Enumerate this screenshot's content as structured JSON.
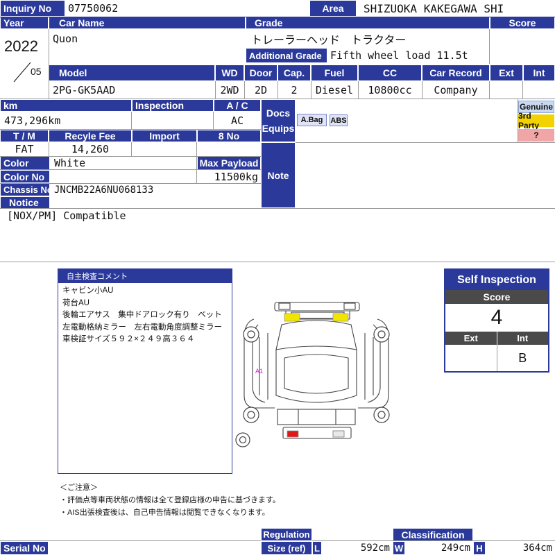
{
  "labels": {
    "inquiry_no": "Inquiry No",
    "area": "Area",
    "year": "Year",
    "car_name": "Car Name",
    "grade": "Grade",
    "score": "Score",
    "additional_grade": "Additional Grade",
    "model": "Model",
    "wd": "WD",
    "door": "Door",
    "cap": "Cap.",
    "fuel": "Fuel",
    "cc": "CC",
    "car_record": "Car Record",
    "ext": "Ext",
    "int": "Int",
    "km": "km",
    "inspection": "Inspection",
    "ac": "A / C",
    "docs": "Docs",
    "equips": "Equips",
    "tm": "T / M",
    "recyle_fee": "Recyle Fee",
    "import": "Import",
    "eight_no": "8 No",
    "color": "Color",
    "max_payload": "Max Payload",
    "color_no": "Color No",
    "note": "Note",
    "chassis_no": "Chassis No",
    "notice": "Notice",
    "serial_no": "Serial No",
    "regulation": "Regulation",
    "size_ref": "Size (ref)",
    "classification": "Classification",
    "size_l": "L",
    "size_w": "W",
    "size_h": "H"
  },
  "vehicle": {
    "inquiry_no": "07750062",
    "area": "SHIZUOKA KAKEGAWA SHI",
    "year": "2022",
    "month": "05",
    "car_name": "Quon",
    "grade": "トレーラーヘッド　トラクター",
    "additional_grade": "Fifth wheel load 11.5t",
    "model": "2PG-GK5AAD",
    "wd": "2WD",
    "door": "2D",
    "cap": "2",
    "fuel": "Diesel",
    "cc": "10800cc",
    "car_record": "Company",
    "km": "473,296km",
    "ac": "AC",
    "tm": "FAT",
    "recycle_fee": "14,260",
    "color": "White",
    "max_payload": "11500kg",
    "chassis_no": "JNCMB22A6NU068133",
    "notice": "[NOX/PM] Compatible",
    "size_l": "592cm",
    "size_w": "249cm",
    "size_h": "364cm"
  },
  "equips": [
    "A.Bag",
    "ABS"
  ],
  "parts_tags": {
    "genuine": "Genuine",
    "third_party": "3rd Party",
    "unknown": "?"
  },
  "comment": {
    "title": "自主検査コメント",
    "lines": [
      "キャビン小AU",
      "荷台AU",
      "後輪エアサス　集中ドアロック有り　ベット",
      "左電動格納ミラー　左右電動角度調整ミラー",
      "車検証サイズ５９２×２４９高３６４"
    ]
  },
  "diagram": {
    "marker": "A1"
  },
  "self_inspection": {
    "title": "Self Inspection",
    "score_label": "Score",
    "score": "4",
    "ext_label": "Ext",
    "int_label": "Int",
    "ext": "",
    "int": "B"
  },
  "notes": {
    "heading": "＜ご注意＞",
    "lines": [
      "・評価点等車両状態の情報は全て登録店様の申告に基づきます。",
      "・AIS出張検査後は、自己申告情報は閲覧できなくなります。"
    ]
  },
  "colors": {
    "header": "#2b3a9a",
    "genuine": "#c9d9f0",
    "third_party": "#f2d200",
    "unknown": "#f0a6a6",
    "damage_yellow": "#f2e600",
    "damage_red": "#e01818",
    "marker": "#d01bd0"
  }
}
